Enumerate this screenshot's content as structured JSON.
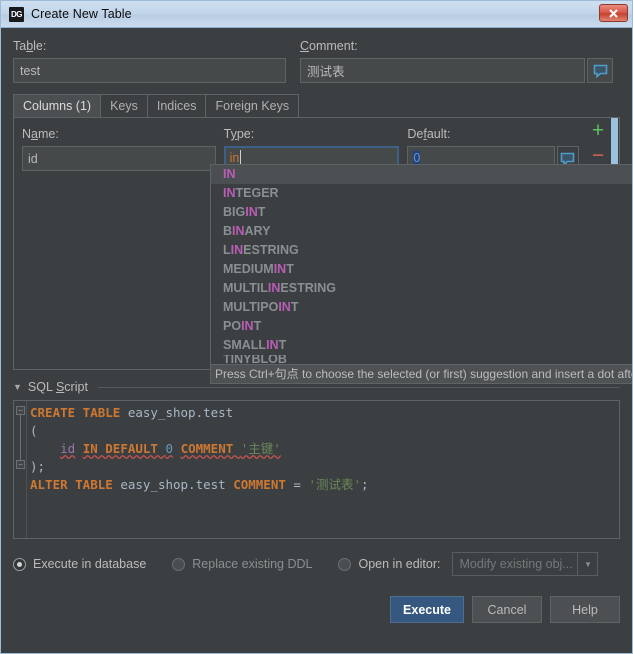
{
  "window": {
    "title": "Create New Table",
    "logo_text": "DG",
    "close_label": "x"
  },
  "form": {
    "table_label": "Table:",
    "table_value": "test",
    "comment_label": "Comment:",
    "comment_value": "测试表",
    "comment_icon": "speech-bubble-icon"
  },
  "tabs": [
    {
      "label": "Columns (1)",
      "active": true
    },
    {
      "label": "Keys",
      "active": false
    },
    {
      "label": "Indices",
      "active": false
    },
    {
      "label": "Foreign Keys",
      "active": false
    }
  ],
  "columns_editor": {
    "name_label": "Name:",
    "type_label": "Type:",
    "default_label": "Default:",
    "name_value": "id",
    "type_value": "in",
    "default_value": "0",
    "add_label": "+",
    "remove_label": "−",
    "row_comment_icon": "speech-bubble-icon"
  },
  "completion": {
    "items": [
      {
        "match": "IN",
        "rest": "",
        "selected": true
      },
      {
        "match": "IN",
        "rest": "TEGER",
        "selected": false
      },
      {
        "pre": "BIG",
        "match": "IN",
        "rest": "T",
        "selected": false
      },
      {
        "pre": "B",
        "match": "IN",
        "rest": "ARY",
        "selected": false
      },
      {
        "pre": "L",
        "match": "IN",
        "rest": "ESTRING",
        "selected": false
      },
      {
        "pre": "MEDIUM",
        "match": "IN",
        "rest": "T",
        "selected": false
      },
      {
        "pre": "MULTIL",
        "match": "IN",
        "rest": "ESTRING",
        "selected": false
      },
      {
        "pre": "MULTIPO",
        "match": "IN",
        "rest": "T",
        "selected": false
      },
      {
        "pre": "PO",
        "match": "IN",
        "rest": "T",
        "selected": false
      },
      {
        "pre": "SMALL",
        "match": "IN",
        "rest": "T",
        "selected": false
      },
      {
        "pre": "TINYBLOB",
        "match": "",
        "rest": "",
        "selected": false
      }
    ],
    "hint": "Press Ctrl+句点 to choose the selected (or first) suggestion and insert a dot afterwards"
  },
  "sql_section": {
    "header": "SQL Script",
    "collapse_icon": "triangle-down-icon",
    "lines": [
      {
        "tokens": [
          {
            "t": "CREATE TABLE ",
            "c": "kw"
          },
          {
            "t": "easy_shop.test",
            "c": "ident"
          }
        ]
      },
      {
        "tokens": [
          {
            "t": "(",
            "c": "op"
          }
        ]
      },
      {
        "tokens": [
          {
            "t": "    ",
            "c": "op"
          },
          {
            "t": "id",
            "c": "col-id squig"
          },
          {
            "t": " ",
            "c": "op"
          },
          {
            "t": "IN DEFAULT ",
            "c": "kw squig"
          },
          {
            "t": "0",
            "c": "num squig"
          },
          {
            "t": " ",
            "c": "op"
          },
          {
            "t": "COMMENT ",
            "c": "kw squig"
          },
          {
            "t": "'主键'",
            "c": "str squig"
          }
        ]
      },
      {
        "tokens": [
          {
            "t": ");",
            "c": "op"
          }
        ]
      },
      {
        "tokens": [
          {
            "t": "ALTER TABLE ",
            "c": "kw"
          },
          {
            "t": "easy_shop.test",
            "c": "ident"
          },
          {
            "t": " ",
            "c": "op"
          },
          {
            "t": "COMMENT ",
            "c": "kw"
          },
          {
            "t": "= ",
            "c": "op"
          },
          {
            "t": "'测试表'",
            "c": "str"
          },
          {
            "t": ";",
            "c": "op"
          }
        ]
      }
    ]
  },
  "options": {
    "execute_in_database": "Execute in database",
    "replace_existing_ddl": "Replace existing DDL",
    "open_in_editor": "Open in editor:",
    "selected": "execute_in_database",
    "editor_combo_value": "Modify existing obj...",
    "combo_arrow_icon": "chevron-down-icon"
  },
  "buttons": {
    "execute": "Execute",
    "cancel": "Cancel",
    "help": "Help"
  }
}
